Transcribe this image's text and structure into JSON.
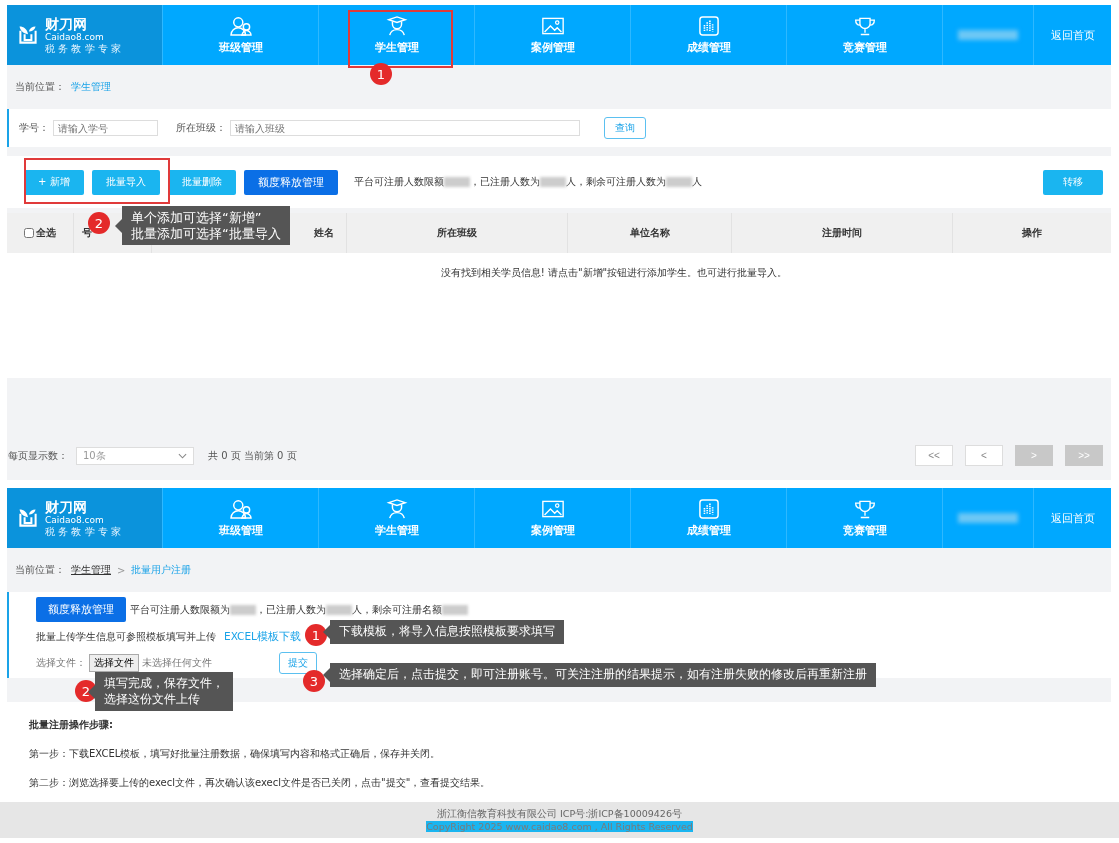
{
  "list_page": {
    "nav": {
      "logo": {
        "name": "财刀网",
        "domain": "Caidao8.com",
        "slogan": "税 务 教 学 专 家"
      },
      "items": [
        {
          "label": "班级管理"
        },
        {
          "label": "学生管理"
        },
        {
          "label": "案例管理"
        },
        {
          "label": "成绩管理"
        },
        {
          "label": "竞赛管理"
        }
      ],
      "home": "返回首页"
    },
    "breadcrumb": {
      "label": "当前位置：",
      "items": [
        "学生管理"
      ]
    },
    "search": {
      "fields": [
        {
          "label": "学号：",
          "placeholder": "请输入学号"
        },
        {
          "label": "所在班级：",
          "placeholder": "请输入班级"
        }
      ],
      "button": "查询"
    },
    "toolbar": {
      "buttons": [
        {
          "label": "+ 新增",
          "kind": "light"
        },
        {
          "label": "批量导入",
          "kind": "light"
        },
        {
          "label": "批量删除",
          "kind": "light"
        },
        {
          "label": "额度释放管理",
          "kind": "strong"
        }
      ],
      "quota": [
        {
          "kind": "text",
          "text": "平台可注册人数限额"
        },
        {
          "kind": "redacted"
        },
        {
          "kind": "text",
          "text": "，已注册人数为"
        },
        {
          "kind": "redacted"
        },
        {
          "kind": "text",
          "text": "人，剩余可注册人数为"
        },
        {
          "kind": "redacted"
        },
        {
          "kind": "text",
          "text": "人"
        }
      ],
      "right_button": "转移"
    },
    "table": {
      "select_all": {
        "label": "全选",
        "checked": false
      },
      "columns": [
        "号",
        "姓名",
        "所在班级",
        "单位名称",
        "注册时间",
        "操作"
      ],
      "empty_message": "没有找到相关学员信息! 请点击\"新增\"按钮进行添加学生。也可进行批量导入。"
    },
    "pagination": {
      "page_size_label": "每页显示数：",
      "page_size": "10条",
      "summary": "共 0 页  当前第 0 页",
      "buttons": [
        {
          "label": "<<",
          "disabled": false
        },
        {
          "label": "<",
          "disabled": false
        },
        {
          "label": ">",
          "disabled": true
        },
        {
          "label": ">>",
          "disabled": true
        }
      ]
    },
    "annotations": [
      {
        "number": "1"
      },
      {
        "number": "2",
        "lines": [
          "单个添加可选择“新增”",
          "批量添加可选择“批量导入"
        ]
      }
    ]
  },
  "import_page": {
    "nav": {
      "logo": {
        "name": "财刀网",
        "domain": "Caidao8.com",
        "slogan": "税 务 教 学 专 家"
      },
      "items": [
        {
          "label": "班级管理"
        },
        {
          "label": "学生管理"
        },
        {
          "label": "案例管理"
        },
        {
          "label": "成绩管理"
        },
        {
          "label": "竞赛管理"
        }
      ],
      "home": "返回首页"
    },
    "breadcrumb": {
      "label": "当前位置：",
      "items": [
        "学生管理",
        "批量用户注册"
      ],
      "separator": ">"
    },
    "quota_button": "额度释放管理",
    "quota": [
      {
        "kind": "text",
        "text": "平台可注册人数限额为"
      },
      {
        "kind": "redacted"
      },
      {
        "kind": "text",
        "text": "，已注册人数为"
      },
      {
        "kind": "redacted"
      },
      {
        "kind": "text",
        "text": "人，剩余可注册名额"
      },
      {
        "kind": "redacted"
      }
    ],
    "template_hint": "批量上传学生信息可参照模板填写并上传",
    "template_link": "EXCEL模板下载",
    "file": {
      "label": "选择文件：",
      "button": "选择文件",
      "status": "未选择任何文件"
    },
    "submit": "提交",
    "steps": {
      "title": "批量注册操作步骤:",
      "items": [
        "第一步：下载EXCEL模板，填写好批量注册数据，确保填写内容和格式正确后，保存并关闭。",
        "第二步：浏览选择要上传的execl文件，再次确认该execl文件是否已关闭，点击\"提交\"，查看提交结果。"
      ]
    },
    "footer": [
      "浙江衡信教育科技有限公司 ICP号:浙ICP备10009426号",
      "CopyRight 2025 www.caidao8.com , All Rights Reserved"
    ],
    "annotations": [
      {
        "number": "1",
        "lines": [
          "下载模板，将导入信息按照模板要求填写"
        ]
      },
      {
        "number": "2",
        "lines": [
          "填写完成，保存文件，",
          "选择这份文件上传"
        ]
      },
      {
        "number": "3",
        "lines": [
          "选择确定后，点击提交，即可注册账号。可关注注册的结果提示，如有注册失败的修改后再重新注册"
        ]
      }
    ]
  }
}
